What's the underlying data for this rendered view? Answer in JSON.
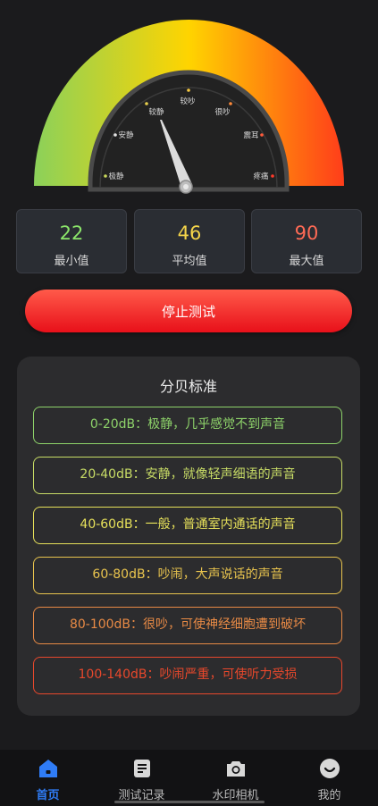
{
  "gauge": {
    "labels": {
      "very_quiet": "极静",
      "quiet": "安静",
      "fairly_quiet": "较静",
      "fairly_noisy": "较吵",
      "noisy": "很吵",
      "deafening": "震耳",
      "painful": "疼痛"
    },
    "colors": {
      "arc_start": "#8bd15a",
      "arc_mid": "#ffd400",
      "arc_end": "#ff3d1a"
    }
  },
  "stats": {
    "min": {
      "value": "22",
      "label": "最小值",
      "color": "#8be56a"
    },
    "avg": {
      "value": "46",
      "label": "平均值",
      "color": "#f5d54a"
    },
    "max": {
      "value": "90",
      "label": "最大值",
      "color": "#ff6a55"
    }
  },
  "stop_button": {
    "label": "停止测试"
  },
  "standards": {
    "title": "分贝标准",
    "items": [
      {
        "text": "0-20dB：极静，几乎感觉不到声音",
        "color": "#8ed36a"
      },
      {
        "text": "20-40dB：安静，就像轻声细语的声音",
        "color": "#c8dc66"
      },
      {
        "text": "40-60dB：一般，普通室内通话的声音",
        "color": "#e6e05a"
      },
      {
        "text": "60-80dB：吵闹，大声说话的声音",
        "color": "#e9c44e"
      },
      {
        "text": "80-100dB：很吵，可使神经细胞遭到破坏",
        "color": "#e88a45"
      },
      {
        "text": "100-140dB：吵闹严重，可使听力受损",
        "color": "#e8482c"
      }
    ]
  },
  "nav": {
    "home": {
      "label": "首页",
      "icon": "home-icon"
    },
    "records": {
      "label": "测试记录",
      "icon": "document-icon"
    },
    "camera": {
      "label": "水印相机",
      "icon": "camera-icon"
    },
    "profile": {
      "label": "我的",
      "icon": "smiley-icon"
    }
  }
}
